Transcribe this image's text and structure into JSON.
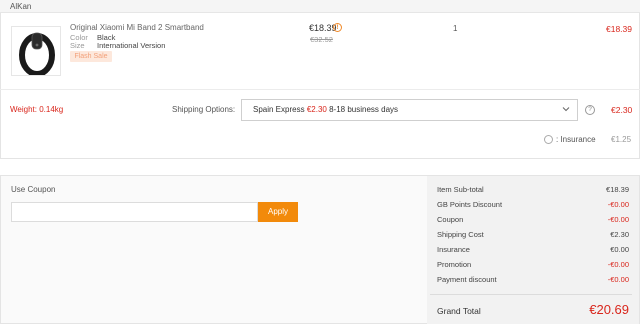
{
  "store": {
    "name": "AlKan"
  },
  "item": {
    "name": "Original Xiaomi Mi Band 2 Smartband",
    "attributes": [
      {
        "key": "Color",
        "value": "Black"
      },
      {
        "key": "Size",
        "value": "International Version"
      }
    ],
    "badge": "Flash Sale",
    "price": "€18.39",
    "price_info_icon": "info-icon",
    "old_price": "€32.52",
    "quantity": "1",
    "row_total": "€18.39"
  },
  "shipping": {
    "weight": "Weight: 0.14kg",
    "label": "Shipping Options:",
    "method": "Spain Express",
    "method_cost": "€2.30",
    "method_time": "8-18 business days",
    "total": "€2.30",
    "insurance_label": ": Insurance",
    "insurance_value": "€1.25"
  },
  "coupon": {
    "title": "Use Coupon",
    "placeholder": "",
    "apply_label": "Apply"
  },
  "summary": {
    "rows": [
      {
        "label": "Item Sub-total",
        "value": "€18.39",
        "negative": false
      },
      {
        "label": "GB Points Discount",
        "value": "-€0.00",
        "negative": true
      },
      {
        "label": "Coupon",
        "value": "-€0.00",
        "negative": true
      },
      {
        "label": "Shipping Cost",
        "value": "€2.30",
        "negative": false
      },
      {
        "label": "Insurance",
        "value": "€0.00",
        "negative": false
      },
      {
        "label": "Promotion",
        "value": "-€0.00",
        "negative": true
      },
      {
        "label": "Payment discount",
        "value": "-€0.00",
        "negative": true
      }
    ],
    "grand_total_label": "Grand Total",
    "grand_total_value": "€20.69"
  },
  "colors": {
    "accent": "#f28a0b",
    "price_red": "#d9261c"
  }
}
